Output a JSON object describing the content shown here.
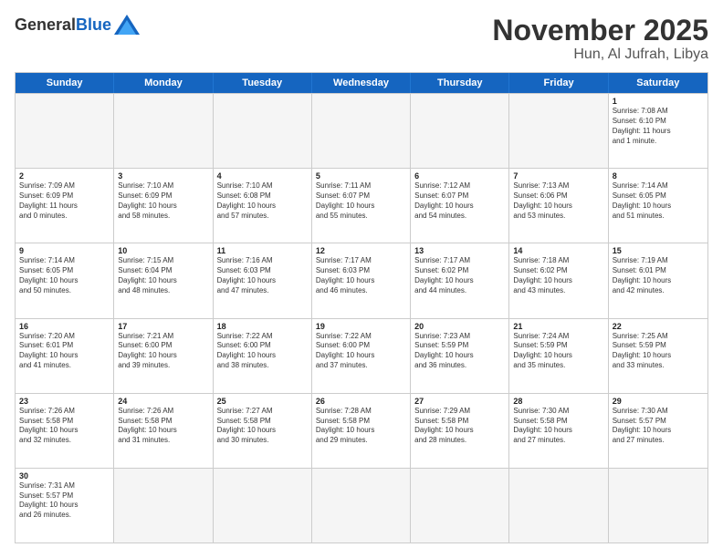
{
  "header": {
    "logo_general": "General",
    "logo_blue": "Blue",
    "month_title": "November 2025",
    "location": "Hun, Al Jufrah, Libya"
  },
  "days_of_week": [
    "Sunday",
    "Monday",
    "Tuesday",
    "Wednesday",
    "Thursday",
    "Friday",
    "Saturday"
  ],
  "weeks": [
    [
      {
        "day": "",
        "info": ""
      },
      {
        "day": "",
        "info": ""
      },
      {
        "day": "",
        "info": ""
      },
      {
        "day": "",
        "info": ""
      },
      {
        "day": "",
        "info": ""
      },
      {
        "day": "",
        "info": ""
      },
      {
        "day": "1",
        "info": "Sunrise: 7:08 AM\nSunset: 6:10 PM\nDaylight: 11 hours\nand 1 minute."
      }
    ],
    [
      {
        "day": "2",
        "info": "Sunrise: 7:09 AM\nSunset: 6:09 PM\nDaylight: 11 hours\nand 0 minutes."
      },
      {
        "day": "3",
        "info": "Sunrise: 7:10 AM\nSunset: 6:09 PM\nDaylight: 10 hours\nand 58 minutes."
      },
      {
        "day": "4",
        "info": "Sunrise: 7:10 AM\nSunset: 6:08 PM\nDaylight: 10 hours\nand 57 minutes."
      },
      {
        "day": "5",
        "info": "Sunrise: 7:11 AM\nSunset: 6:07 PM\nDaylight: 10 hours\nand 55 minutes."
      },
      {
        "day": "6",
        "info": "Sunrise: 7:12 AM\nSunset: 6:07 PM\nDaylight: 10 hours\nand 54 minutes."
      },
      {
        "day": "7",
        "info": "Sunrise: 7:13 AM\nSunset: 6:06 PM\nDaylight: 10 hours\nand 53 minutes."
      },
      {
        "day": "8",
        "info": "Sunrise: 7:14 AM\nSunset: 6:05 PM\nDaylight: 10 hours\nand 51 minutes."
      }
    ],
    [
      {
        "day": "9",
        "info": "Sunrise: 7:14 AM\nSunset: 6:05 PM\nDaylight: 10 hours\nand 50 minutes."
      },
      {
        "day": "10",
        "info": "Sunrise: 7:15 AM\nSunset: 6:04 PM\nDaylight: 10 hours\nand 48 minutes."
      },
      {
        "day": "11",
        "info": "Sunrise: 7:16 AM\nSunset: 6:03 PM\nDaylight: 10 hours\nand 47 minutes."
      },
      {
        "day": "12",
        "info": "Sunrise: 7:17 AM\nSunset: 6:03 PM\nDaylight: 10 hours\nand 46 minutes."
      },
      {
        "day": "13",
        "info": "Sunrise: 7:17 AM\nSunset: 6:02 PM\nDaylight: 10 hours\nand 44 minutes."
      },
      {
        "day": "14",
        "info": "Sunrise: 7:18 AM\nSunset: 6:02 PM\nDaylight: 10 hours\nand 43 minutes."
      },
      {
        "day": "15",
        "info": "Sunrise: 7:19 AM\nSunset: 6:01 PM\nDaylight: 10 hours\nand 42 minutes."
      }
    ],
    [
      {
        "day": "16",
        "info": "Sunrise: 7:20 AM\nSunset: 6:01 PM\nDaylight: 10 hours\nand 41 minutes."
      },
      {
        "day": "17",
        "info": "Sunrise: 7:21 AM\nSunset: 6:00 PM\nDaylight: 10 hours\nand 39 minutes."
      },
      {
        "day": "18",
        "info": "Sunrise: 7:22 AM\nSunset: 6:00 PM\nDaylight: 10 hours\nand 38 minutes."
      },
      {
        "day": "19",
        "info": "Sunrise: 7:22 AM\nSunset: 6:00 PM\nDaylight: 10 hours\nand 37 minutes."
      },
      {
        "day": "20",
        "info": "Sunrise: 7:23 AM\nSunset: 5:59 PM\nDaylight: 10 hours\nand 36 minutes."
      },
      {
        "day": "21",
        "info": "Sunrise: 7:24 AM\nSunset: 5:59 PM\nDaylight: 10 hours\nand 35 minutes."
      },
      {
        "day": "22",
        "info": "Sunrise: 7:25 AM\nSunset: 5:59 PM\nDaylight: 10 hours\nand 33 minutes."
      }
    ],
    [
      {
        "day": "23",
        "info": "Sunrise: 7:26 AM\nSunset: 5:58 PM\nDaylight: 10 hours\nand 32 minutes."
      },
      {
        "day": "24",
        "info": "Sunrise: 7:26 AM\nSunset: 5:58 PM\nDaylight: 10 hours\nand 31 minutes."
      },
      {
        "day": "25",
        "info": "Sunrise: 7:27 AM\nSunset: 5:58 PM\nDaylight: 10 hours\nand 30 minutes."
      },
      {
        "day": "26",
        "info": "Sunrise: 7:28 AM\nSunset: 5:58 PM\nDaylight: 10 hours\nand 29 minutes."
      },
      {
        "day": "27",
        "info": "Sunrise: 7:29 AM\nSunset: 5:58 PM\nDaylight: 10 hours\nand 28 minutes."
      },
      {
        "day": "28",
        "info": "Sunrise: 7:30 AM\nSunset: 5:58 PM\nDaylight: 10 hours\nand 27 minutes."
      },
      {
        "day": "29",
        "info": "Sunrise: 7:30 AM\nSunset: 5:57 PM\nDaylight: 10 hours\nand 27 minutes."
      }
    ],
    [
      {
        "day": "30",
        "info": "Sunrise: 7:31 AM\nSunset: 5:57 PM\nDaylight: 10 hours\nand 26 minutes."
      },
      {
        "day": "",
        "info": ""
      },
      {
        "day": "",
        "info": ""
      },
      {
        "day": "",
        "info": ""
      },
      {
        "day": "",
        "info": ""
      },
      {
        "day": "",
        "info": ""
      },
      {
        "day": "",
        "info": ""
      }
    ]
  ]
}
